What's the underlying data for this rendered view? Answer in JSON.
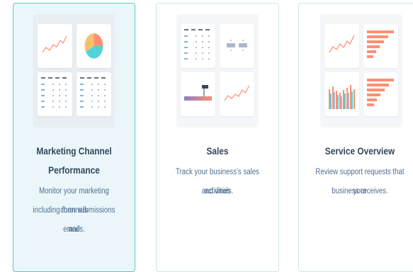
{
  "cards": [
    {
      "title_line1": "Marketing Channel",
      "title_line2": "Performance",
      "desc_line1": "Monitor your marketing channels",
      "desc_line2": "including form submissions and",
      "desc_line3": "emails.",
      "selected": true
    },
    {
      "title_line1": "Sales",
      "desc_line1": "Track your business's sales activities",
      "desc_line2": "and deals.",
      "selected": false
    },
    {
      "title_line1": "Service Overview",
      "desc_line1": "Review support requests that your",
      "desc_line2": "business receives.",
      "selected": false
    }
  ],
  "colors": {
    "accent_border": "#67c3cf",
    "selected_bg": "#eaf6f9",
    "title_text": "#33475b",
    "desc_text": "#516f90",
    "chart_orange": "#ff8f73",
    "chart_teal": "#51d3d9",
    "chart_yellow": "#f5c26b",
    "chart_blue_gray": "#a9b8cf",
    "chart_purple": "#8b7fc4"
  }
}
